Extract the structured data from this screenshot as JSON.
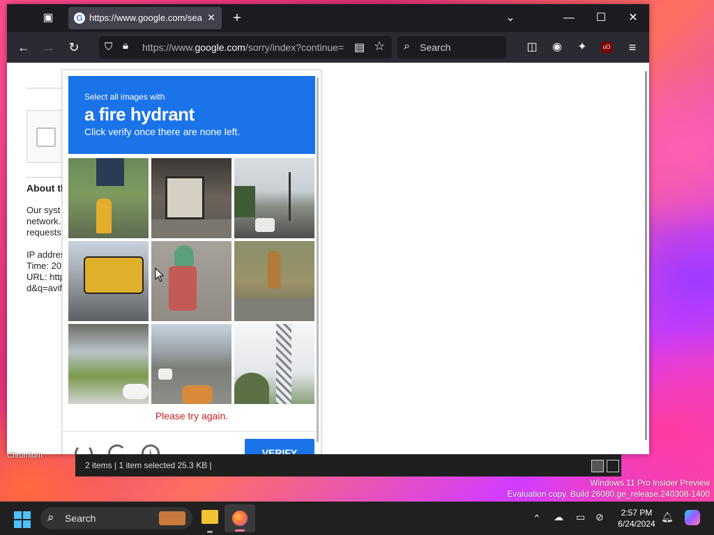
{
  "browser": {
    "tab": {
      "title": "https://www.google.com/search",
      "favicon": "G"
    },
    "url": {
      "prefix": "https://www.",
      "host": "google.com",
      "path": "/sorry/index?continue="
    },
    "search_placeholder": "Search"
  },
  "page": {
    "about_heading": "About th",
    "lines": [
      "Our syst",
      "network.",
      "requests"
    ],
    "ip_lines": [
      "IP addres",
      "Time: 20",
      "URL: http",
      "d&q=avif"
    ]
  },
  "captcha": {
    "line1": "Select all images with",
    "line2": "a fire hydrant",
    "line3": "Click verify once there are none left.",
    "error": "Please try again.",
    "verify_label": "VERIFY"
  },
  "explorer": {
    "behind_label": "Chromium",
    "status": "2 items  |  1 item selected  25.3 KB  |"
  },
  "watermark": {
    "line1": "Windows 11 Pro Insider Preview",
    "line2": "Evaluation copy. Build 26080.ge_release.240308-1400"
  },
  "taskbar": {
    "search_label": "Search",
    "time": "2:57 PM",
    "date": "6/24/2024"
  },
  "colors": {
    "captcha_blue": "#1a73e8",
    "error_red": "#c5221f",
    "taskbar": "#202020"
  }
}
